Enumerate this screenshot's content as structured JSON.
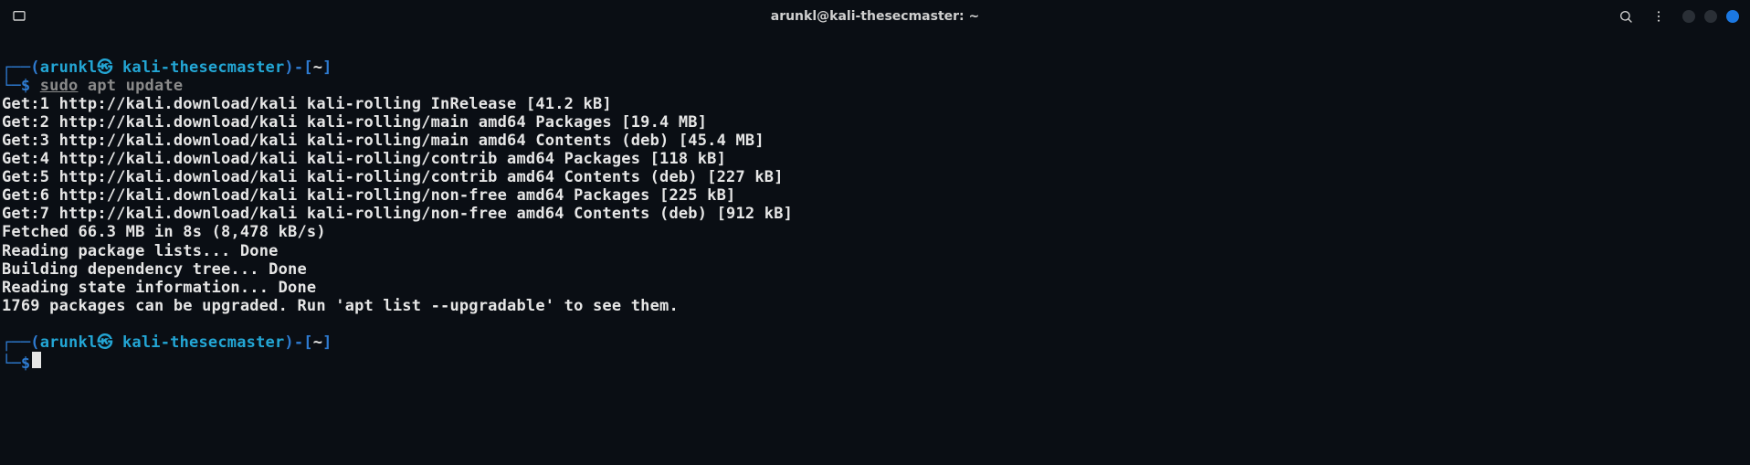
{
  "titlebar": {
    "title": "arunkl@kali-thesecmaster: ~"
  },
  "colors": {
    "cyan": "#23a6d5",
    "blue": "#2e7bd1",
    "bg": "#0a0e14",
    "close": "#1b78e2",
    "wdot": "#2a2f36"
  },
  "prompt1": {
    "box_top_l": "┌──(",
    "user": "arunkl",
    "skull": "㉿",
    "host": "kali-thesecmaster",
    "box_top_r": ")-[",
    "path": "~",
    "box_top_r2": "]",
    "box_bot": "└─",
    "dollar": "$",
    "cmd_sudo": "sudo",
    "cmd_rest": " apt update"
  },
  "output": [
    "Get:1 http://kali.download/kali kali-rolling InRelease [41.2 kB]",
    "Get:2 http://kali.download/kali kali-rolling/main amd64 Packages [19.4 MB]",
    "Get:3 http://kali.download/kali kali-rolling/main amd64 Contents (deb) [45.4 MB]",
    "Get:4 http://kali.download/kali kali-rolling/contrib amd64 Packages [118 kB]",
    "Get:5 http://kali.download/kali kali-rolling/contrib amd64 Contents (deb) [227 kB]",
    "Get:6 http://kali.download/kali kali-rolling/non-free amd64 Packages [225 kB]",
    "Get:7 http://kali.download/kali kali-rolling/non-free amd64 Contents (deb) [912 kB]",
    "Fetched 66.3 MB in 8s (8,478 kB/s)",
    "Reading package lists... Done",
    "Building dependency tree... Done",
    "Reading state information... Done",
    "1769 packages can be upgraded. Run 'apt list --upgradable' to see them."
  ],
  "prompt2": {
    "box_top_l": "┌──(",
    "user": "arunkl",
    "skull": "㉿",
    "host": "kali-thesecmaster",
    "box_top_r": ")-[",
    "path": "~",
    "box_top_r2": "]",
    "box_bot": "└─",
    "dollar": "$"
  }
}
